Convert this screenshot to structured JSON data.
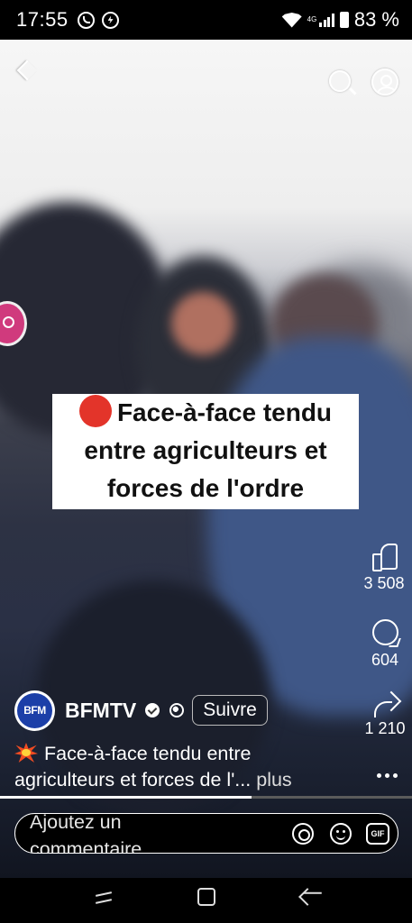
{
  "status_bar": {
    "time": "17:55",
    "battery": "83 %",
    "network": "4G"
  },
  "video": {
    "headline_lines": [
      "Face-à-face tendu",
      "entre agriculteurs et",
      "forces de l'ordre"
    ],
    "progress_fraction": 0.61
  },
  "actions": {
    "likes": "3 508",
    "comments": "604",
    "shares": "1 210"
  },
  "channel": {
    "avatar_text": "BFM",
    "name": "BFMTV",
    "follow_label": "Suivre"
  },
  "caption": {
    "line1": "Face-à-face tendu entre",
    "line2": "agriculteurs et forces de l'...",
    "more_label": "plus"
  },
  "comment_box": {
    "placeholder": "Ajoutez un commentaire",
    "gif_label": "GIF"
  },
  "colors": {
    "accent_red": "#e3342a",
    "brand_blue": "#1c3fa8"
  }
}
